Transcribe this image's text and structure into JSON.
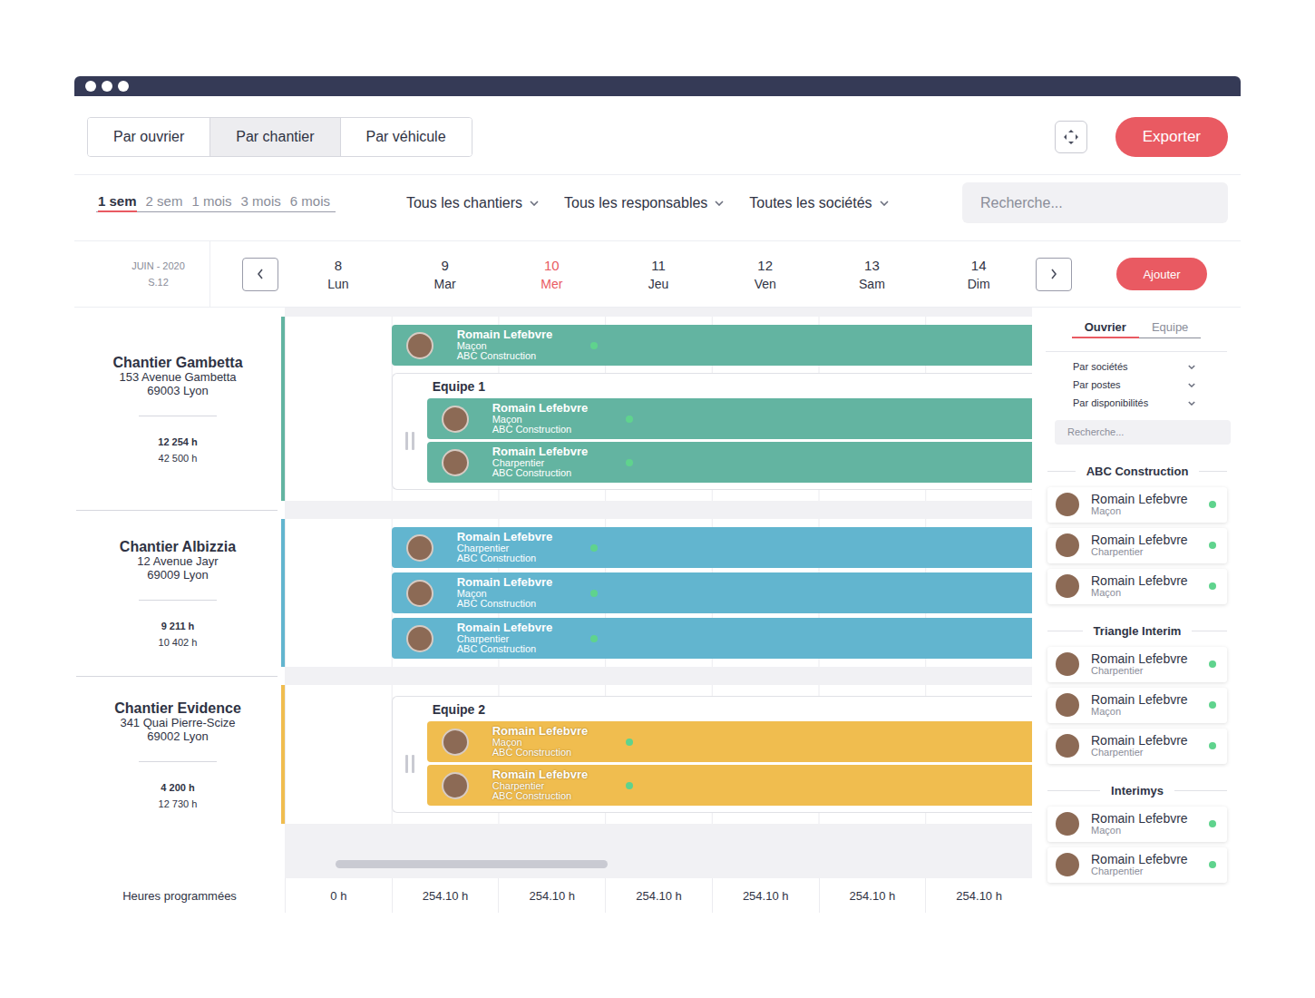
{
  "view_tabs": [
    {
      "label": "Par ouvrier",
      "selected": false
    },
    {
      "label": "Par chantier",
      "selected": true
    },
    {
      "label": "Par véhicule",
      "selected": false
    }
  ],
  "export_button": "Exporter",
  "periods": [
    {
      "label": "1 sem",
      "selected": true
    },
    {
      "label": "2 sem",
      "selected": false
    },
    {
      "label": "1 mois",
      "selected": false
    },
    {
      "label": "3 mois",
      "selected": false
    },
    {
      "label": "6 mois",
      "selected": false
    }
  ],
  "filters": [
    "Tous les chantiers",
    "Tous les responsables",
    "Toutes les sociétés"
  ],
  "search": {
    "placeholder": "Recherche..."
  },
  "calendar": {
    "month": "JUIN - 2020",
    "week": "S.12",
    "add_button": "Ajouter",
    "days": [
      {
        "num": "8",
        "name": "Lun",
        "today": false
      },
      {
        "num": "9",
        "name": "Mar",
        "today": false
      },
      {
        "num": "10",
        "name": "Mer",
        "today": true
      },
      {
        "num": "11",
        "name": "Jeu",
        "today": false
      },
      {
        "num": "12",
        "name": "Ven",
        "today": false
      },
      {
        "num": "13",
        "name": "Sam",
        "today": false
      },
      {
        "num": "14",
        "name": "Dim",
        "today": false
      }
    ]
  },
  "chantiers": [
    {
      "name": "Chantier Gambetta",
      "address": [
        "153 Avenue Gambetta",
        "69003 Lyon"
      ],
      "planned": "12 254 h",
      "budget": "42 500 h",
      "color": "#63b4a1",
      "entries": [
        {
          "kind": "worker",
          "start": 1,
          "name": "Romain Lefebvre",
          "role": "Maçon",
          "company": "ABC Construction",
          "available": true
        },
        {
          "kind": "team",
          "start": 1,
          "title": "Equipe 1",
          "members": [
            {
              "name": "Romain Lefebvre",
              "role": "Maçon",
              "company": "ABC Construction",
              "available": true
            },
            {
              "name": "Romain Lefebvre",
              "role": "Charpentier",
              "company": "ABC Construction",
              "available": true
            }
          ]
        }
      ]
    },
    {
      "name": "Chantier Albizzia",
      "address": [
        "12 Avenue Jayr",
        "69009 Lyon"
      ],
      "planned": "9 211 h",
      "budget": "10 402 h",
      "color": "#62b5cf",
      "entries": [
        {
          "kind": "worker",
          "start": 1,
          "name": "Romain Lefebvre",
          "role": "Charpentier",
          "company": "ABC Construction",
          "available": true
        },
        {
          "kind": "worker",
          "start": 1,
          "name": "Romain Lefebvre",
          "role": "Maçon",
          "company": "ABC Construction",
          "available": true
        },
        {
          "kind": "worker",
          "start": 1,
          "name": "Romain Lefebvre",
          "role": "Charpentier",
          "company": "ABC Construction",
          "available": true
        }
      ]
    },
    {
      "name": "Chantier Evidence",
      "address": [
        "341 Quai Pierre-Scize",
        "69002 Lyon"
      ],
      "planned": "4 200 h",
      "budget": "12 730 h",
      "color": "#f0bd4f",
      "entries": [
        {
          "kind": "team",
          "start": 1,
          "title": "Equipe 2",
          "members": [
            {
              "name": "Romain Lefebvre",
              "role": "Maçon",
              "company": "ABC Construction",
              "available": true
            },
            {
              "name": "Romain Lefebvre",
              "role": "Charpentier",
              "company": "ABC Construction",
              "available": true
            }
          ]
        }
      ]
    }
  ],
  "scrollbar": {
    "level": 0.39
  },
  "footer": {
    "label": "Heures programmées",
    "totals": [
      "0 h",
      "254.10 h",
      "254.10 h",
      "254.10 h",
      "254.10 h",
      "254.10 h",
      "254.10 h"
    ]
  },
  "panel": {
    "tabs": [
      {
        "label": "Ouvrier",
        "selected": true
      },
      {
        "label": "Equipe",
        "selected": false
      }
    ],
    "filters": [
      "Par sociétés",
      "Par postes",
      "Par disponibilités"
    ],
    "search": {
      "placeholder": "Recherche..."
    },
    "groups": [
      {
        "name": "ABC Construction",
        "workers": [
          {
            "name": "Romain Lefebvre",
            "role": "Maçon",
            "available": true
          },
          {
            "name": "Romain Lefebvre",
            "role": "Charpentier",
            "available": true
          },
          {
            "name": "Romain Lefebvre",
            "role": "Maçon",
            "available": true
          }
        ]
      },
      {
        "name": "Triangle Interim",
        "workers": [
          {
            "name": "Romain Lefebvre",
            "role": "Charpentier",
            "available": true
          },
          {
            "name": "Romain Lefebvre",
            "role": "Maçon",
            "available": true
          },
          {
            "name": "Romain Lefebvre",
            "role": "Charpentier",
            "available": true
          }
        ]
      },
      {
        "name": "Interimys",
        "workers": [
          {
            "name": "Romain Lefebvre",
            "role": "Maçon",
            "available": true
          },
          {
            "name": "Romain Lefebvre",
            "role": "Charpentier",
            "available": true
          }
        ]
      }
    ]
  }
}
